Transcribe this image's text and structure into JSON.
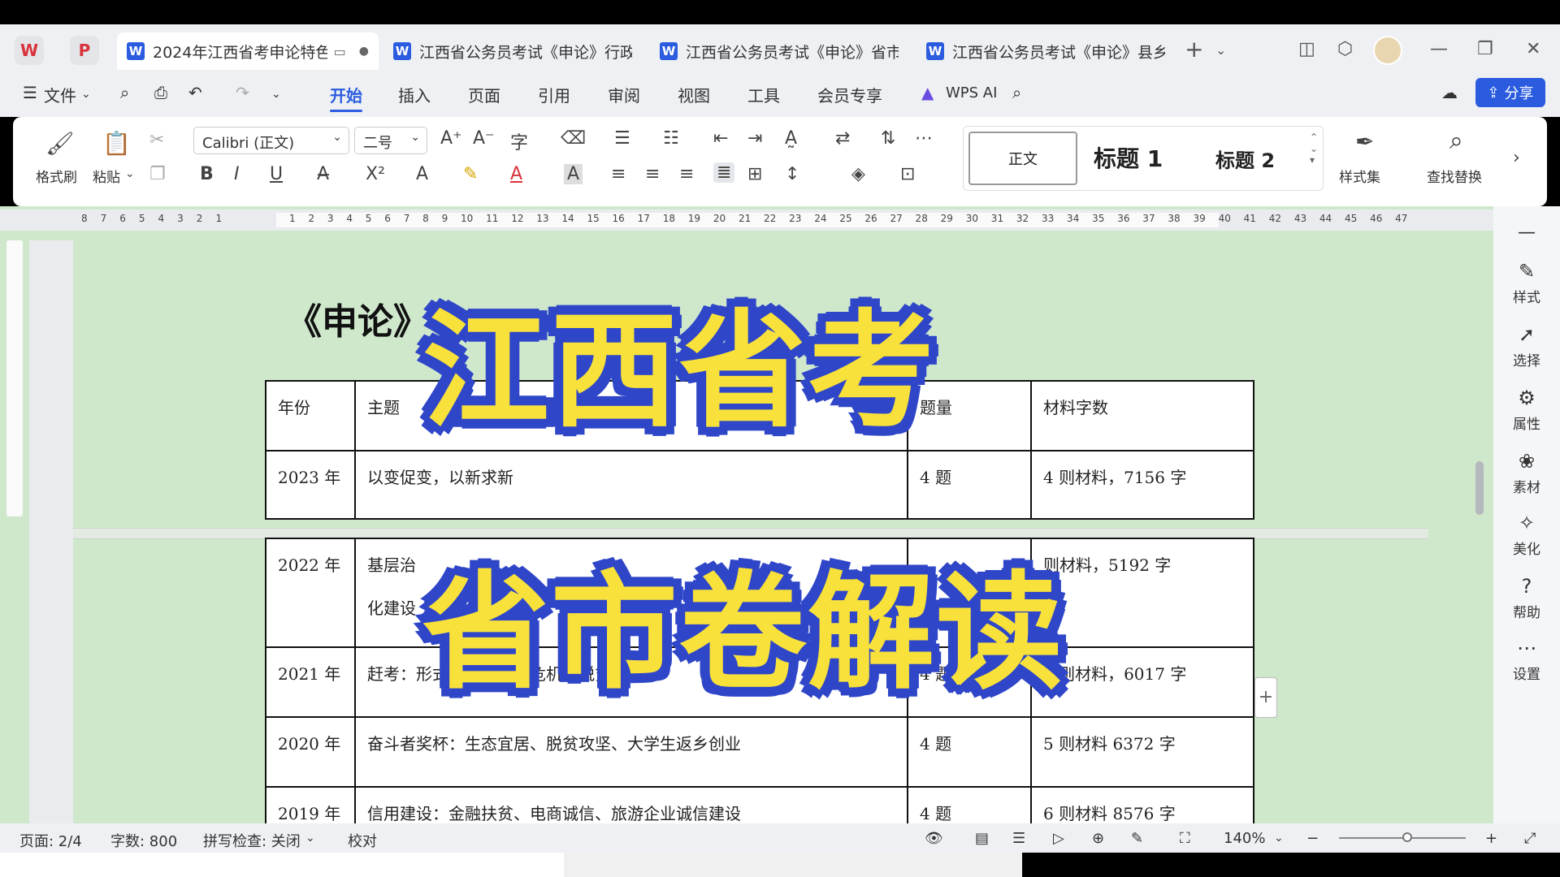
{
  "tabs": {
    "doc1": "2024年江西省考申论特色",
    "doc2": "江西省公务员考试《申论》行政",
    "doc3": "江西省公务员考试《申论》省市",
    "doc4": "江西省公务员考试《申论》县乡"
  },
  "menu": {
    "file": "文件",
    "start": "开始",
    "insert": "插入",
    "page": "页面",
    "reference": "引用",
    "review": "审阅",
    "view": "视图",
    "tools": "工具",
    "member": "会员专享",
    "wps_ai": "WPS AI",
    "share": "分享"
  },
  "ribbon": {
    "format_painter": "格式刷",
    "paste": "粘贴",
    "font_name": "Calibri (正文)",
    "font_size": "二号",
    "style_body": "正文",
    "style_h1": "标题 1",
    "style_h2": "标题 2",
    "style_set": "样式集",
    "find_replace": "查找替换"
  },
  "document": {
    "title": "《申论》",
    "table": {
      "header": [
        "年份",
        "主题",
        "题量",
        "材料字数"
      ],
      "rows": [
        [
          "2023 年",
          "以变促变，以新求新",
          "4 题",
          "4 则材料，7156 字"
        ],
        [
          "2022 年",
          "基层治",
          "",
          "则材料，5192 字"
        ],
        [
          "2021 年",
          "赶考：形式主义、企业危机、脱贫攻坚",
          "4 题",
          "6 则材料，6017 字"
        ],
        [
          "2020 年",
          "奋斗者奖杯：生态宜居、脱贫攻坚、大学生返乡创业",
          "4 题",
          "5 则材料 6372 字"
        ],
        [
          "2019 年",
          "信用建设：金融扶贫、电商诚信、旅游企业诚信建设",
          "4 题",
          "6 则材料 8576 字"
        ]
      ],
      "row2_line2": "化建设"
    }
  },
  "overlay": {
    "line1": "江西省考",
    "line2": "省市卷解读"
  },
  "right_panel": {
    "style": "样式",
    "select": "选择",
    "property": "属性",
    "material": "素材",
    "beautify": "美化",
    "help": "帮助",
    "settings": "设置"
  },
  "status": {
    "page": "页面: 2/4",
    "words": "字数: 800",
    "spell": "拼写检查: 关闭",
    "proof": "校对",
    "zoom": "140%"
  },
  "colors": {
    "accent": "#2b5ce0",
    "page_bg": "#cfe8cc",
    "overlay_fill": "#f8e13a",
    "overlay_stroke": "#2f46c8"
  }
}
